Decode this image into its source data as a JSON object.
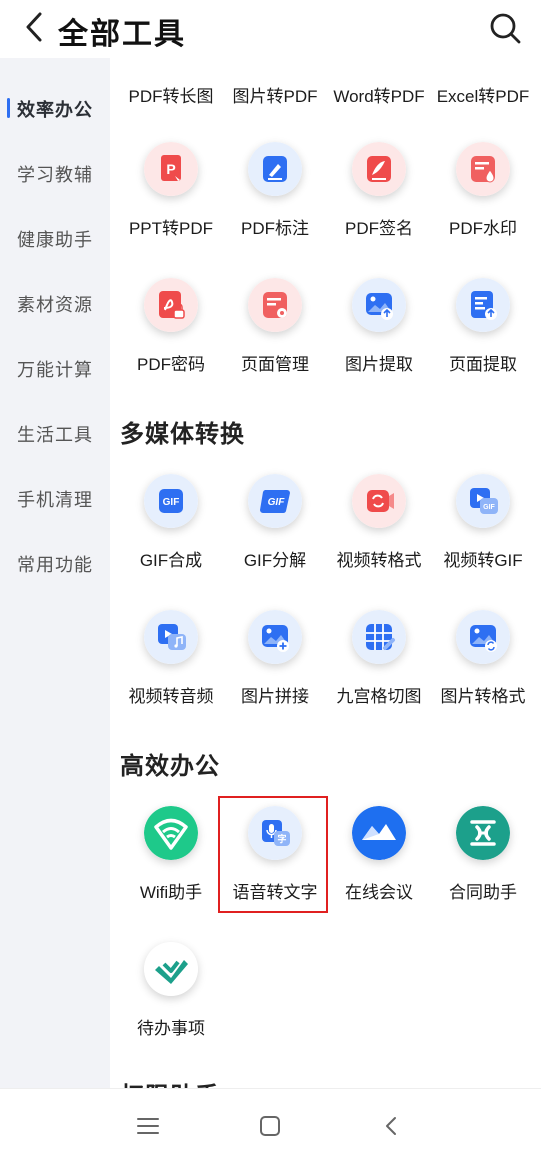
{
  "header": {
    "title": "全部工具",
    "back_icon": "chevron-left-icon",
    "search_icon": "search-icon"
  },
  "sidebar": {
    "active_index": 0,
    "items": [
      {
        "label": "效率办公"
      },
      {
        "label": "学习教辅"
      },
      {
        "label": "健康助手"
      },
      {
        "label": "素材资源"
      },
      {
        "label": "万能计算"
      },
      {
        "label": "生活工具"
      },
      {
        "label": "手机清理"
      },
      {
        "label": "常用功能"
      }
    ]
  },
  "pdf_partial_row": [
    "PDF转长图",
    "图片转PDF",
    "Word转PDF",
    "Excel转PDF"
  ],
  "pdf_rows": [
    [
      {
        "name": "PPT转PDF",
        "icon": "ppt-to-pdf-icon"
      },
      {
        "name": "PDF标注",
        "icon": "pdf-annotate-icon"
      },
      {
        "name": "PDF签名",
        "icon": "pdf-sign-icon"
      },
      {
        "name": "PDF水印",
        "icon": "pdf-watermark-icon"
      }
    ],
    [
      {
        "name": "PDF密码",
        "icon": "pdf-password-icon"
      },
      {
        "name": "页面管理",
        "icon": "page-manage-icon"
      },
      {
        "name": "图片提取",
        "icon": "image-extract-icon"
      },
      {
        "name": "页面提取",
        "icon": "page-extract-icon"
      }
    ]
  ],
  "multimedia": {
    "title": "多媒体转换",
    "rows": [
      [
        {
          "name": "GIF合成",
          "icon": "gif-compose-icon"
        },
        {
          "name": "GIF分解",
          "icon": "gif-split-icon"
        },
        {
          "name": "视频转格式",
          "icon": "video-convert-icon"
        },
        {
          "name": "视频转GIF",
          "icon": "video-to-gif-icon"
        }
      ],
      [
        {
          "name": "视频转音频",
          "icon": "video-to-audio-icon"
        },
        {
          "name": "图片拼接",
          "icon": "image-stitch-icon"
        },
        {
          "name": "九宫格切图",
          "icon": "grid-cut-icon"
        },
        {
          "name": "图片转格式",
          "icon": "image-convert-icon"
        }
      ]
    ]
  },
  "office": {
    "title": "高效办公",
    "rows": [
      [
        {
          "name": "Wifi助手",
          "icon": "wifi-icon"
        },
        {
          "name": "语音转文字",
          "icon": "speech-to-text-icon",
          "highlighted": true
        },
        {
          "name": "在线会议",
          "icon": "meeting-icon"
        },
        {
          "name": "合同助手",
          "icon": "contract-icon"
        }
      ],
      [
        {
          "name": "待办事项",
          "icon": "todo-icon"
        }
      ]
    ]
  },
  "next_section_partial": "权限助手",
  "navbar": {
    "menu_icon": "menu-icon",
    "home_icon": "home-icon",
    "back_icon": "back-icon"
  },
  "colors": {
    "accent_blue": "#2e6ff2",
    "pdf_red": "#ef4b4b",
    "highlight_red": "#e02020",
    "wifi_green": "#1ec98a",
    "contract_teal": "#1ca08b",
    "sidebar_bg": "#f2f3f7"
  }
}
